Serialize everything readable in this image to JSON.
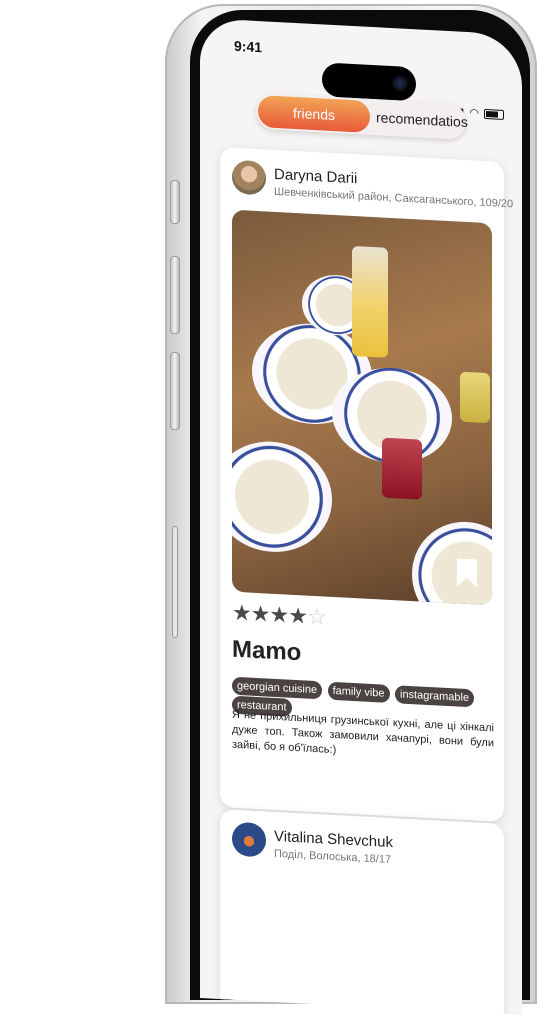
{
  "status": {
    "time": "9:41"
  },
  "tabs": {
    "active": "friends",
    "inactive": "recomendatios"
  },
  "posts": [
    {
      "author": "Daryna Darii",
      "address": "Шевченківський район, Саксаганського, 109/20",
      "rating": 4,
      "rating_max": 5,
      "place": "Mamo",
      "tags": [
        "georgian cuisine",
        "family vibe",
        "instagramable",
        "restaurant"
      ],
      "review": "Я не прихильниця грузинської кухні, але ці хінкалі дуже топ. Також замовили хачапурі, вони були зайві, бо я об'їлась:)"
    },
    {
      "author": "Vitalina Shevchuk",
      "address": "Поділ, Волоська, 18/17"
    }
  ],
  "icons": {
    "bookmark": "bookmark-icon",
    "star": "star-icon"
  },
  "colors": {
    "accent_start": "#f2a356",
    "accent_end": "#e85a3a",
    "tag_bg": "#4b4342"
  }
}
